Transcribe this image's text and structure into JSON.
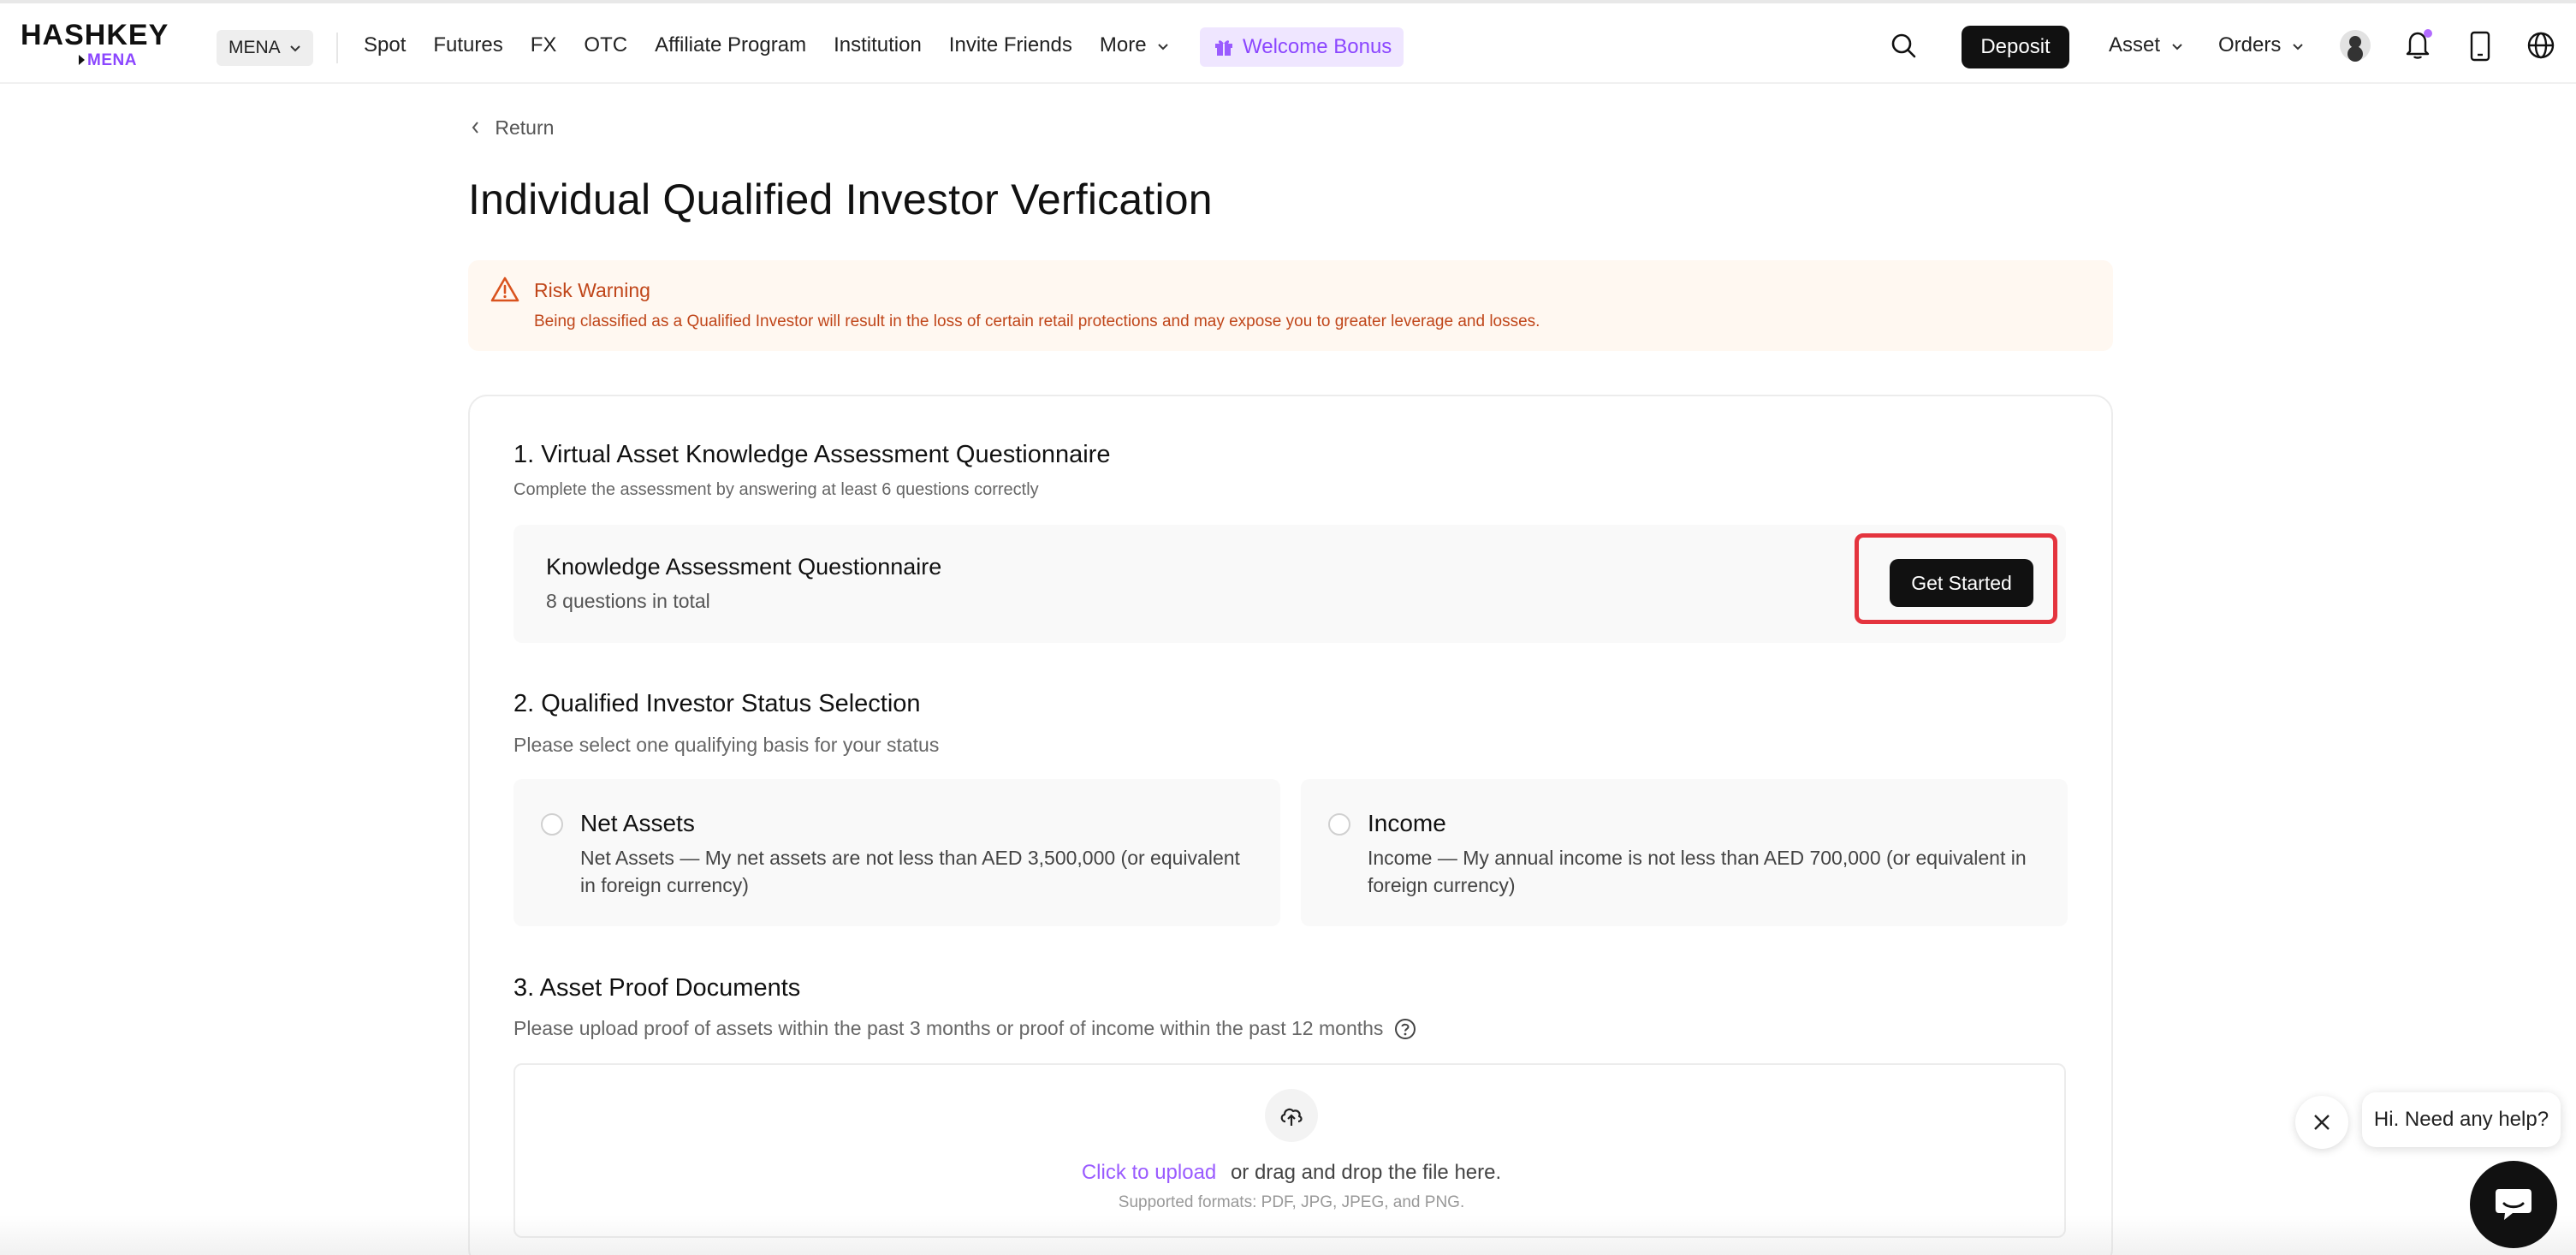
{
  "header": {
    "logo_main": "HASHKEY",
    "logo_sub": "MENA",
    "region": "MENA",
    "nav": [
      "Spot",
      "Futures",
      "FX",
      "OTC",
      "Affiliate Program",
      "Institution",
      "Invite Friends"
    ],
    "more_label": "More",
    "bonus_label": "Welcome Bonus",
    "deposit_label": "Deposit",
    "asset_label": "Asset",
    "orders_label": "Orders",
    "accent_color": "#8b46ff"
  },
  "page": {
    "return_label": "Return",
    "title": "Individual Qualified Investor Verfication"
  },
  "risk": {
    "title": "Risk Warning",
    "text": "Being classified as a Qualified Investor will result in the loss of certain retail protections and may expose you to greater leverage and losses.",
    "color": "#c0461a"
  },
  "section1": {
    "title": "1. Virtual Asset Knowledge Assessment Questionnaire",
    "subtitle": "Complete the assessment by answering at least 6 questions correctly",
    "box_title": "Knowledge Assessment Questionnaire",
    "box_sub": "8 questions in total",
    "button": "Get Started"
  },
  "section2": {
    "title": "2. Qualified Investor Status Selection",
    "subtitle": "Please select one qualifying basis for your status",
    "options": [
      {
        "title": "Net Assets",
        "desc": "Net Assets — My net assets are not less than AED 3,500,000 (or equivalent in foreign currency)",
        "selected": false
      },
      {
        "title": "Income",
        "desc": "Income — My annual income is not less than AED 700,000 (or equivalent in foreign currency)",
        "selected": false
      }
    ]
  },
  "section3": {
    "title": "3. Asset Proof Documents",
    "subtitle": "Please upload proof of assets within the past 3 months or proof of income within the past 12 months",
    "upload_link": "Click to upload",
    "upload_text": "or drag and drop the file here.",
    "formats": "Supported formats: PDF, JPG, JPEG, and PNG."
  },
  "chat": {
    "bubble": "Hi. Need any help?"
  }
}
